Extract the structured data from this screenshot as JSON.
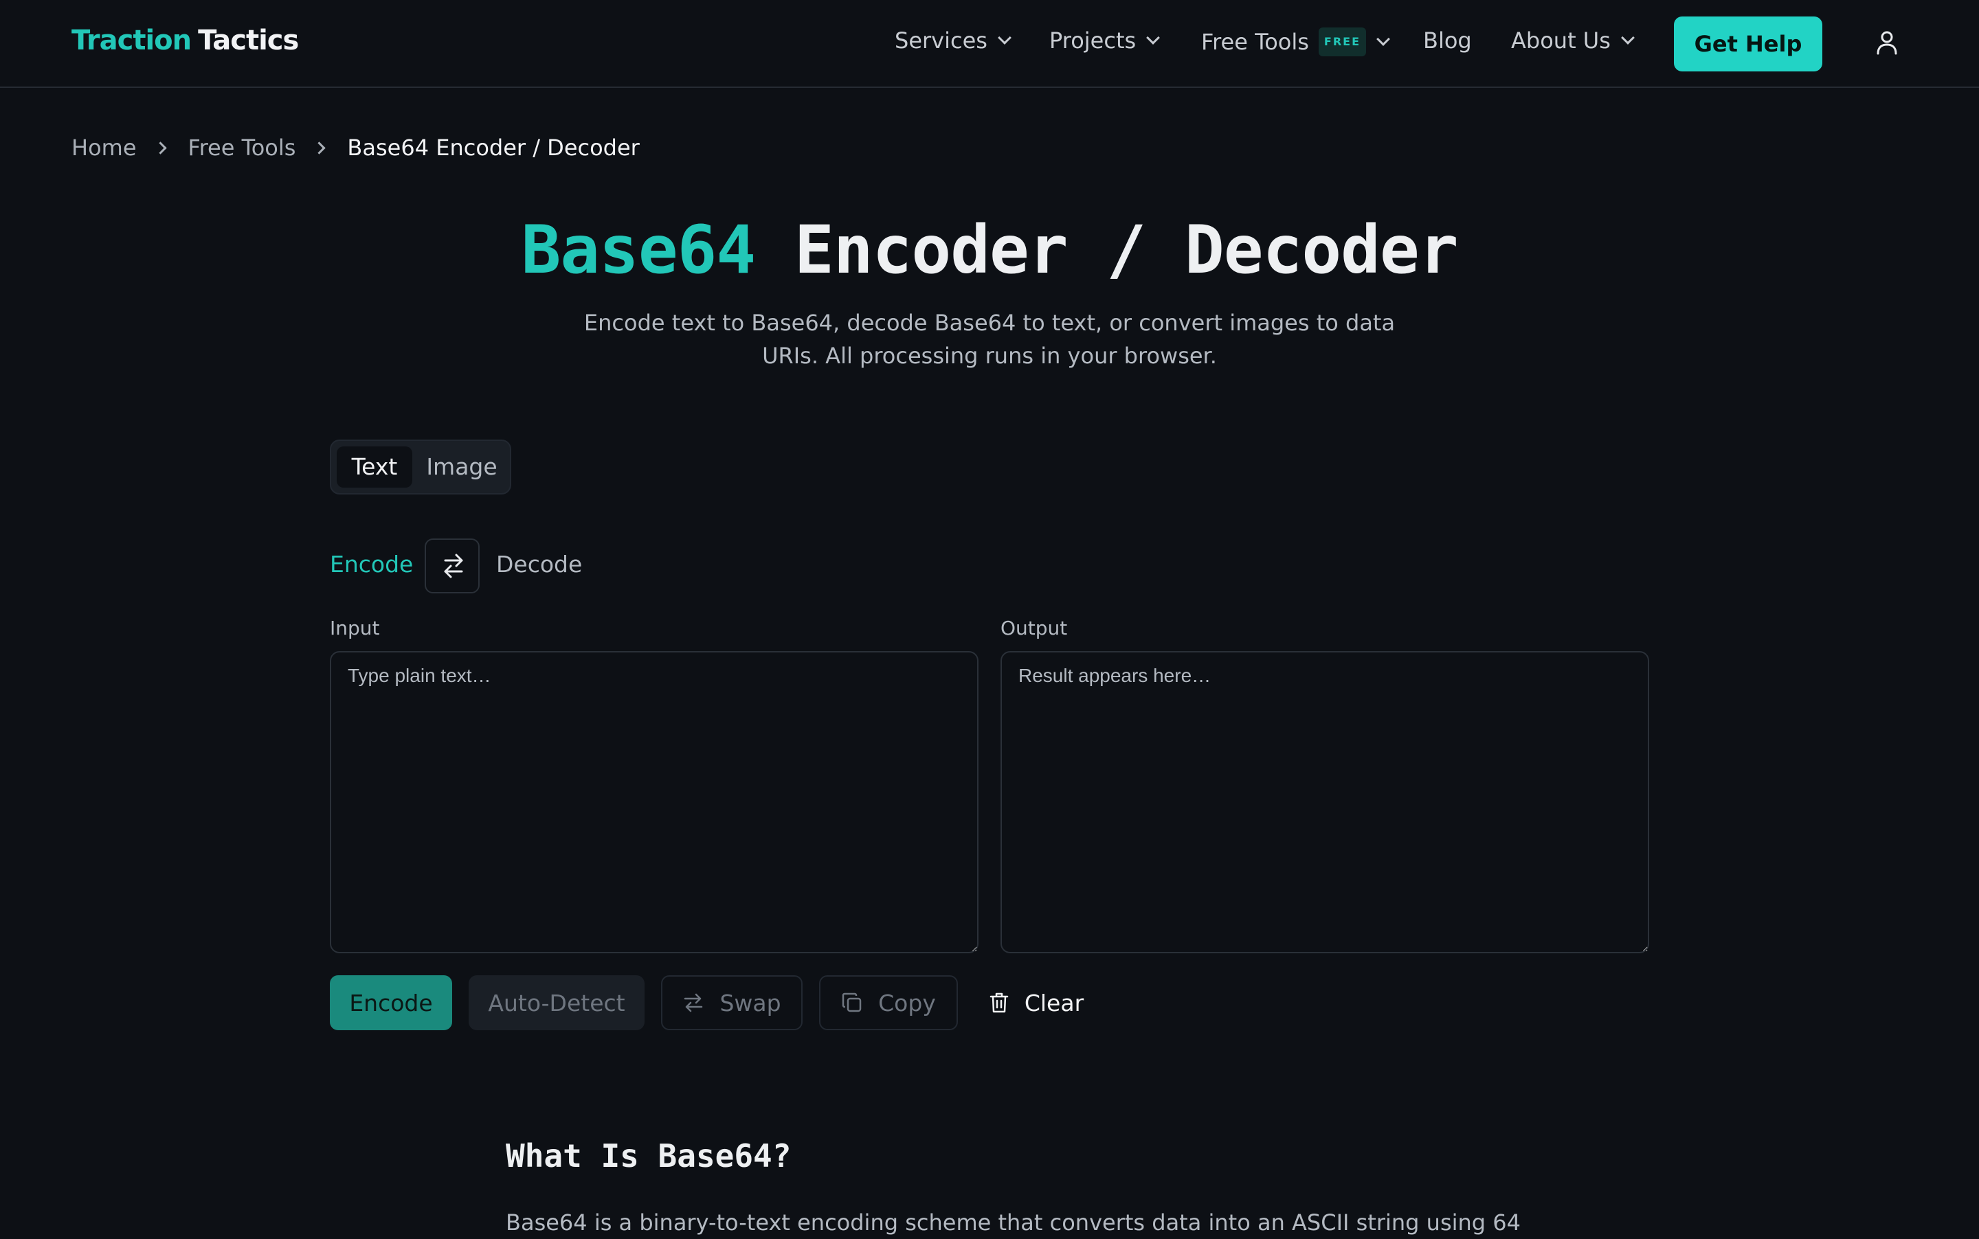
{
  "header": {
    "logo_part1": "Traction",
    "logo_part2": "Tactics",
    "nav": {
      "services": "Services",
      "projects": "Projects",
      "free_tools": "Free Tools",
      "free_badge": "FREE",
      "blog": "Blog",
      "about": "About Us"
    },
    "cta": "Get Help"
  },
  "breadcrumb": {
    "home": "Home",
    "free_tools": "Free Tools",
    "current": "Base64 Encoder / Decoder"
  },
  "hero": {
    "title_highlight": "Base64",
    "title_rest": " Encoder / Decoder",
    "subtitle": "Encode text to Base64, decode Base64 to text, or convert images to data URIs. All processing runs in your browser."
  },
  "mode_tabs": {
    "text": "Text",
    "image": "Image",
    "selected": "Text"
  },
  "direction": {
    "encode": "Encode",
    "decode": "Decode",
    "selected": "Encode"
  },
  "editor": {
    "input_label": "Input",
    "input_placeholder": "Type plain text…",
    "input_value": "",
    "output_label": "Output",
    "output_placeholder": "Result appears here…",
    "output_value": ""
  },
  "actions": {
    "encode": "Encode",
    "auto_detect": "Auto-Detect",
    "swap": "Swap",
    "copy": "Copy",
    "clear": "Clear"
  },
  "article": {
    "heading": "What Is Base64?",
    "intro": "Base64 is a binary-to-text encoding scheme that converts data into an ASCII string using 64"
  },
  "colors": {
    "accent": "#22c7b8",
    "cta_bg": "#22d3c5",
    "background": "#0d1015",
    "primary_button": "#1a8a7d"
  },
  "icons": {
    "nav_dropdown": "chevron-down-icon",
    "breadcrumb_separator": "chevron-right-icon",
    "account": "user-icon",
    "direction_toggle": "swap-arrows-icon",
    "copy": "copy-icon",
    "clear": "trash-icon"
  }
}
